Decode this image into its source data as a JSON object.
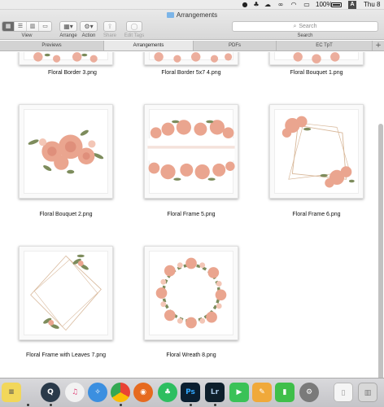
{
  "menubar": {
    "battery_text": "100%",
    "user_initial": "A",
    "clock": "Thu 8"
  },
  "window": {
    "title": "Arrangements"
  },
  "toolbar": {
    "view_label": "View",
    "arrange_label": "Arrange",
    "action_label": "Action",
    "share_label": "Share",
    "edit_tags_label": "Edit Tags",
    "search_placeholder": "Search",
    "search_label": "Search"
  },
  "tabs": [
    {
      "label": "Previews"
    },
    {
      "label": "Arrangements"
    },
    {
      "label": "PDFs"
    },
    {
      "label": "EC TpT"
    }
  ],
  "files": [
    {
      "name": "Floral Border 3.png"
    },
    {
      "name": "Floral Border 5x7 4.png"
    },
    {
      "name": "Floral Bouquet 1.png"
    },
    {
      "name": "Floral Bouquet 2.png"
    },
    {
      "name": "Floral Frame 5.png"
    },
    {
      "name": "Floral Frame 6.png"
    },
    {
      "name": "Floral Frame with Leaves 7.png"
    },
    {
      "name": "Floral Wreath 8.png"
    }
  ],
  "dock": [
    {
      "icon": "notes-icon",
      "color": "#f2d75a"
    },
    {
      "icon": "quicktime-icon",
      "color": "#2a3a4a"
    },
    {
      "icon": "itunes-icon",
      "color": "#f2f2f2"
    },
    {
      "icon": "safari-icon",
      "color": "#3b8fe0"
    },
    {
      "icon": "chrome-icon",
      "color": "#ffffff"
    },
    {
      "icon": "firefox-icon",
      "color": "#e66a1f"
    },
    {
      "icon": "evernote-icon",
      "color": "#2dbe60"
    },
    {
      "icon": "photoshop-icon",
      "color": "#0a1e30",
      "text": "Ps"
    },
    {
      "icon": "lightroom-icon",
      "color": "#0e1f2c",
      "text": "Lr"
    },
    {
      "icon": "facetime-icon",
      "color": "#3ac257"
    },
    {
      "icon": "pages-icon",
      "color": "#f0a93a"
    },
    {
      "icon": "numbers-icon",
      "color": "#3fbf4a"
    },
    {
      "icon": "system-preferences-icon",
      "color": "#7a7a7a"
    },
    {
      "icon": "document-icon",
      "color": "#f5f5f5"
    },
    {
      "icon": "trash-icon",
      "color": "#d8d8d8"
    }
  ]
}
